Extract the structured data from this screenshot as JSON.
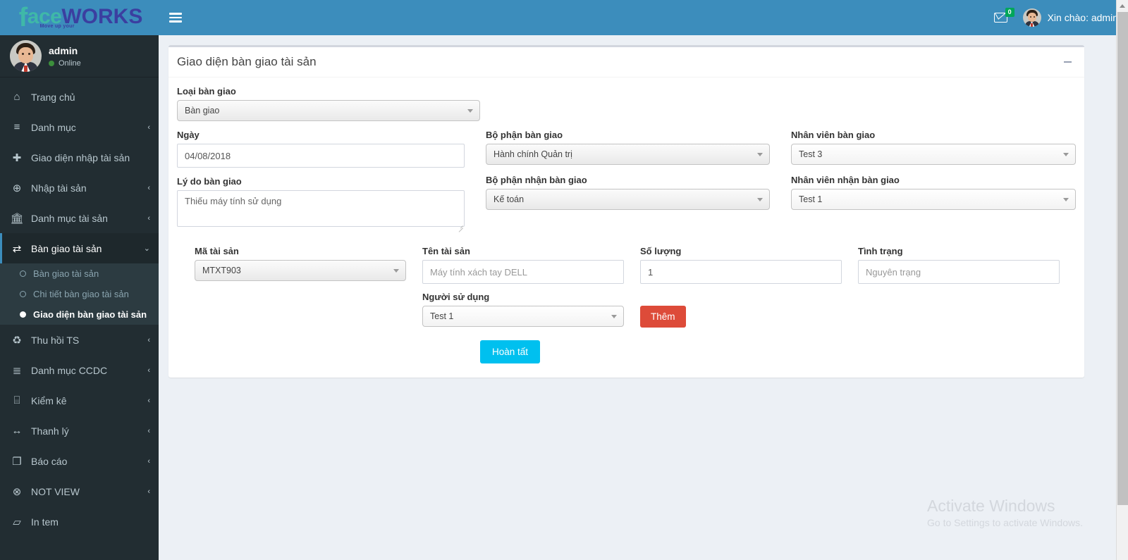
{
  "brand": {
    "logo_f": "f",
    "logo_ace": "ace",
    "logo_works": "WORKS",
    "logo_tagline": "Move up your"
  },
  "sidebar": {
    "user": {
      "name": "admin",
      "status": "Online"
    },
    "items": [
      {
        "label": "Trang chủ",
        "icon": "home-icon",
        "glyph": "⌂",
        "caret": ""
      },
      {
        "label": "Danh mục",
        "icon": "list-icon",
        "glyph": "≡",
        "caret": "‹"
      },
      {
        "label": "Giao diện nhập tài sản",
        "icon": "plus-icon",
        "glyph": "✚",
        "caret": ""
      },
      {
        "label": "Nhập tài sản",
        "icon": "plus-circle-icon",
        "glyph": "⊕",
        "caret": "‹"
      },
      {
        "label": "Danh mục tài sản",
        "icon": "bank-icon",
        "glyph": "🏛",
        "caret": "‹"
      },
      {
        "label": "Bàn giao tài sản",
        "icon": "exchange-icon",
        "glyph": "⇄",
        "caret": "⌄"
      },
      {
        "label": "Thu hồi TS",
        "icon": "recycle-icon",
        "glyph": "♻",
        "caret": "‹"
      },
      {
        "label": "Danh mục CCDC",
        "icon": "server-icon",
        "glyph": "≣",
        "caret": "‹"
      },
      {
        "label": "Kiểm kê",
        "icon": "database-icon",
        "glyph": "⌸",
        "caret": "‹"
      },
      {
        "label": "Thanh lý",
        "icon": "arrows-h-icon",
        "glyph": "↔",
        "caret": "‹"
      },
      {
        "label": "Báo cáo",
        "icon": "file-icon",
        "glyph": "❐",
        "caret": "‹"
      },
      {
        "label": "NOT VIEW",
        "icon": "times-circle-icon",
        "glyph": "⊗",
        "caret": "‹"
      },
      {
        "label": "In tem",
        "icon": "book-icon",
        "glyph": "▱",
        "caret": ""
      }
    ],
    "submenu": [
      {
        "label": "Bàn giao tài sản",
        "active": false
      },
      {
        "label": "Chi tiết bàn giao tài sản",
        "active": false
      },
      {
        "label": "Giao diện bàn giao tài sản",
        "active": true
      }
    ]
  },
  "topbar": {
    "menu_toggle": "hamburger",
    "mail_badge": "0",
    "greeting": "Xin chào: admin"
  },
  "panel": {
    "title": "Giao diện bàn giao tài sản",
    "collapse": "minus"
  },
  "form": {
    "loai_ban_giao": {
      "label": "Loại bàn giao",
      "value": "Bàn giao"
    },
    "ngay": {
      "label": "Ngày",
      "value": "04/08/2018"
    },
    "ly_do": {
      "label": "Lý do bàn giao",
      "value": "Thiếu máy tính sử dụng"
    },
    "bo_phan_ban_giao": {
      "label": "Bộ phận bàn giao",
      "value": "Hành chính Quản trị"
    },
    "bo_phan_nhan": {
      "label": "Bộ phận nhận bàn giao",
      "value": "Kế toán"
    },
    "nhan_vien_ban_giao": {
      "label": "Nhân viên bàn giao",
      "value": "Test 3"
    },
    "nhan_vien_nhan": {
      "label": "Nhân viên nhận bàn giao",
      "value": "Test 1"
    },
    "ma_tai_san": {
      "label": "Mã tài sản",
      "value": "MTXT903"
    },
    "ten_tai_san": {
      "label": "Tên tài sản",
      "value": "Máy tính xách tay DELL"
    },
    "so_luong": {
      "label": "Số lượng",
      "value": "1"
    },
    "tinh_trang": {
      "label": "Tình trạng",
      "value": "Nguyên trạng"
    },
    "nguoi_su_dung": {
      "label": "Người sử dụng",
      "value": "Test 1"
    },
    "btn_them": "Thêm",
    "btn_hoan_tat": "Hoàn tất"
  },
  "watermark": {
    "line1": "Activate Windows",
    "line2": "Go to Settings to activate Windows."
  },
  "colors": {
    "header_blue": "#3c8dbc",
    "sidebar_dark": "#222d32",
    "content_bg": "#ecf0f5",
    "btn_add_red": "#dd4b39",
    "btn_done_cyan": "#00c0ef",
    "online_green": "#3c8f3c"
  }
}
